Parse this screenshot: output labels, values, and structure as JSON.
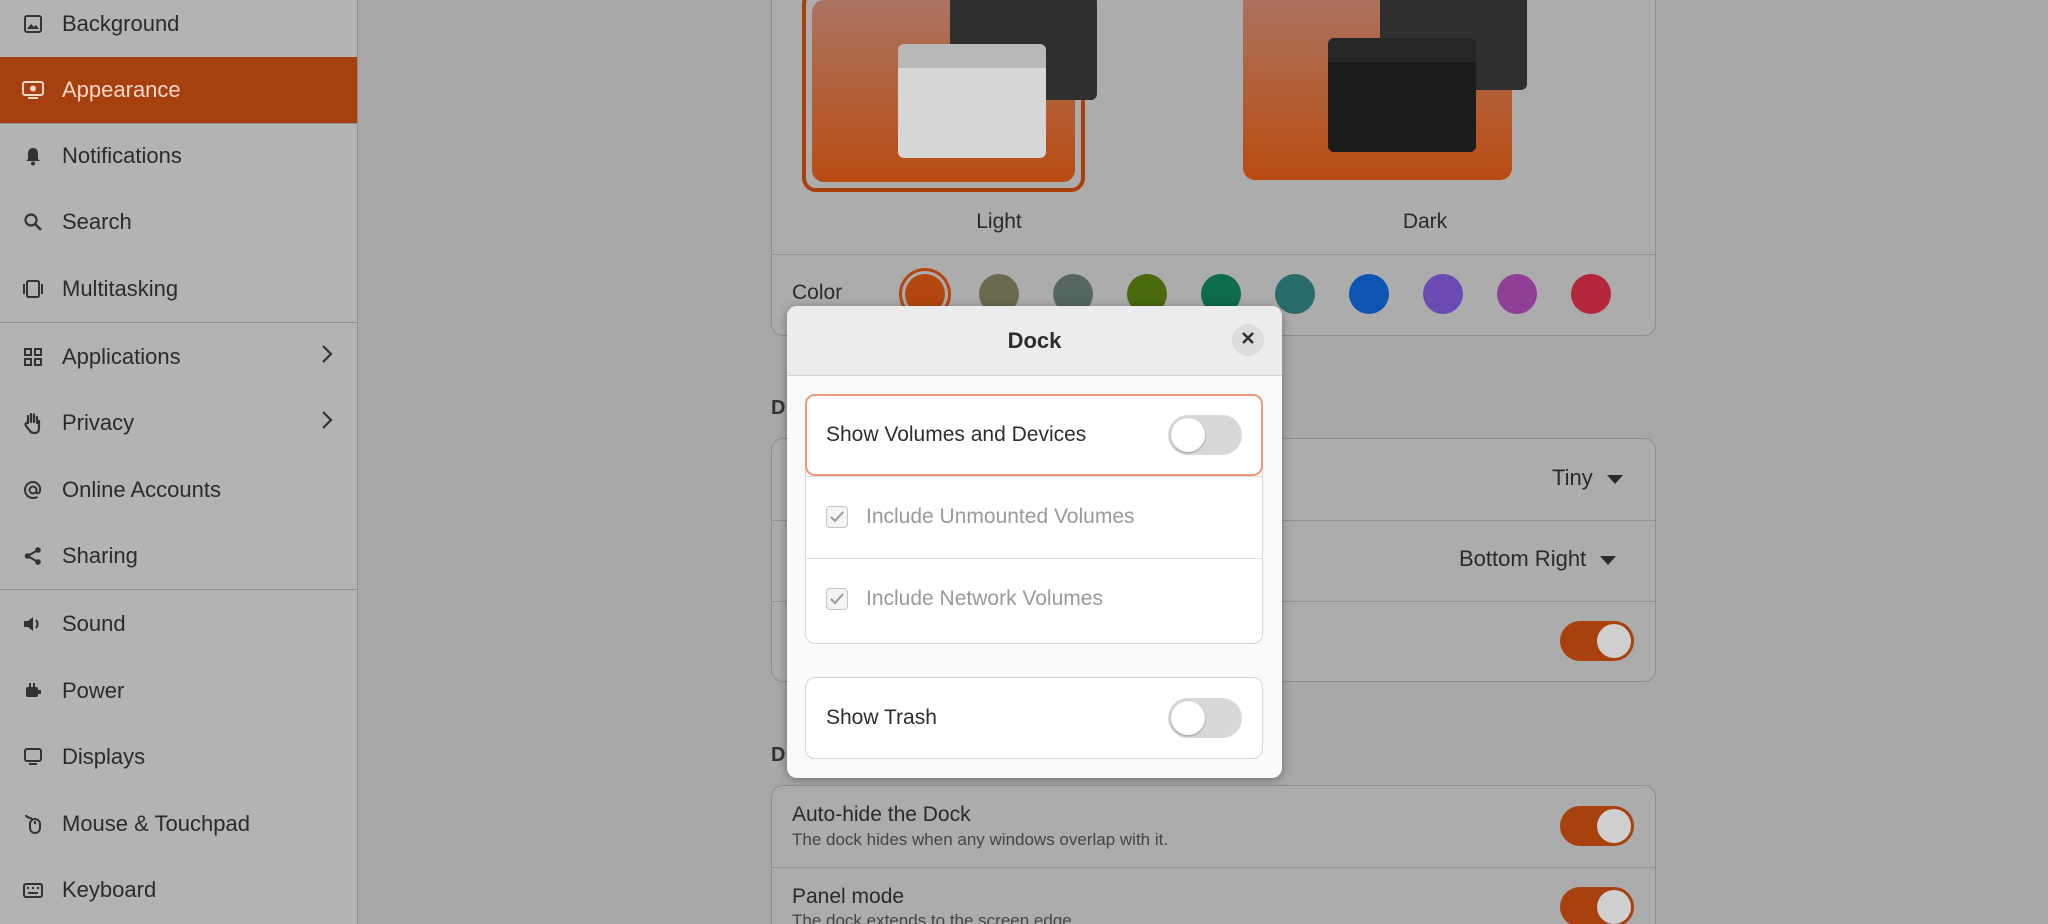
{
  "sidebar": {
    "items": [
      {
        "label": "Background",
        "icon": "image-icon"
      },
      {
        "label": "Appearance",
        "icon": "appearance-icon",
        "active": true
      },
      {
        "label": "Notifications",
        "icon": "bell-icon"
      },
      {
        "label": "Search",
        "icon": "search-icon"
      },
      {
        "label": "Multitasking",
        "icon": "multitasking-icon"
      },
      {
        "label": "Applications",
        "icon": "apps-grid-icon",
        "chevron": true
      },
      {
        "label": "Privacy",
        "icon": "hand-icon",
        "chevron": true
      },
      {
        "label": "Online Accounts",
        "icon": "at-icon"
      },
      {
        "label": "Sharing",
        "icon": "share-icon"
      },
      {
        "label": "Sound",
        "icon": "speaker-icon"
      },
      {
        "label": "Power",
        "icon": "power-icon"
      },
      {
        "label": "Displays",
        "icon": "display-icon"
      },
      {
        "label": "Mouse & Touchpad",
        "icon": "mouse-icon"
      },
      {
        "label": "Keyboard",
        "icon": "keyboard-icon"
      }
    ]
  },
  "appearance": {
    "styles": [
      {
        "label": "Light",
        "selected": true
      },
      {
        "label": "Dark",
        "selected": false
      }
    ],
    "color_label": "Color",
    "colors": [
      "#b3470f",
      "#6b6a4f",
      "#566660",
      "#4b6a0e",
      "#0e6c4a",
      "#2a6b6b",
      "#0e55b3",
      "#6b4bb3",
      "#8f3f96",
      "#b3263b"
    ],
    "accent": "#a9410e"
  },
  "desktop_icons": {
    "section_letter": "D",
    "size_value": "Tiny",
    "position_value": "Bottom Right"
  },
  "dock_section": {
    "section_letter": "D",
    "autohide_title": "Auto-hide the Dock",
    "autohide_sub": "The dock hides when any windows overlap with it.",
    "panel_title": "Panel mode",
    "panel_sub": "The dock extends to the screen edge."
  },
  "dialog": {
    "title": "Dock",
    "show_volumes": "Show Volumes and Devices",
    "include_unmounted": "Include Unmounted Volumes",
    "include_network": "Include Network Volumes",
    "show_trash": "Show Trash"
  }
}
